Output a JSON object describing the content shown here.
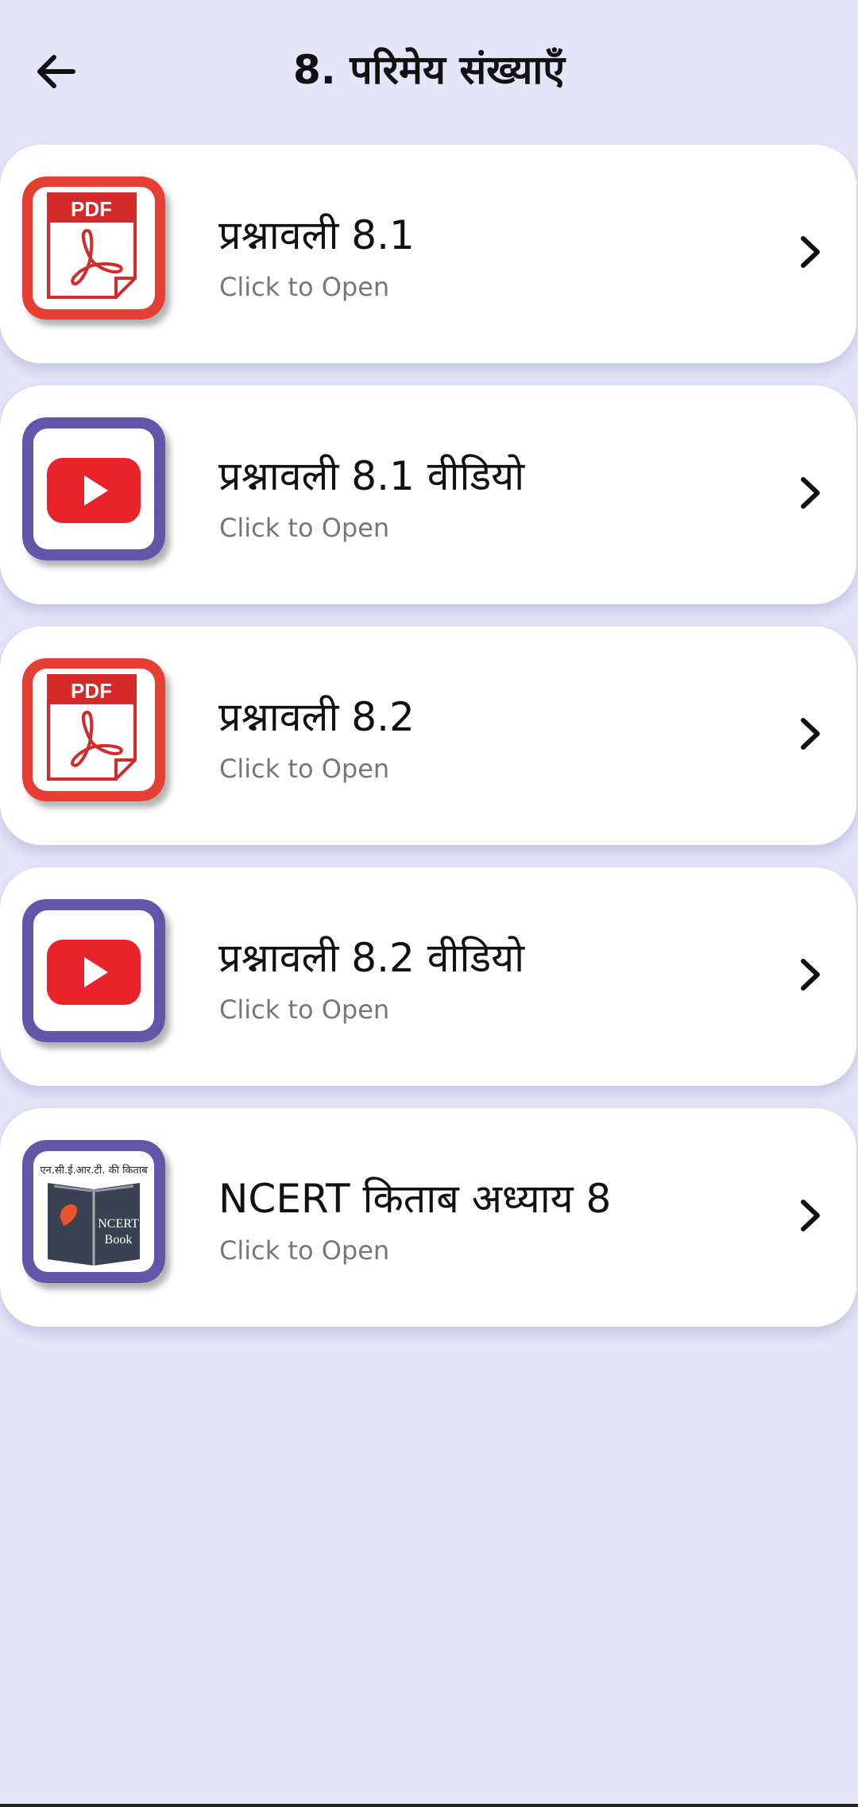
{
  "header": {
    "title": "8. परिमेय संख्याएँ",
    "back_icon": "arrow-left-icon"
  },
  "items": [
    {
      "title": "प्रश्नावली 8.1",
      "subtitle": "Click to Open",
      "icon": "pdf-icon",
      "frame_color": "#e0322f"
    },
    {
      "title": "प्रश्नावली 8.1 वीडियो",
      "subtitle": "Click to Open",
      "icon": "youtube-video-icon",
      "frame_color": "#6455a8"
    },
    {
      "title": "प्रश्नावली 8.2",
      "subtitle": "Click to Open",
      "icon": "pdf-icon",
      "frame_color": "#e0322f"
    },
    {
      "title": "प्रश्नावली 8.2 वीडियो",
      "subtitle": "Click to Open",
      "icon": "youtube-video-icon",
      "frame_color": "#6455a8"
    },
    {
      "title": "NCERT किताब अध्याय 8",
      "subtitle": "Click to Open",
      "icon": "ncert-book-icon",
      "frame_color": "#6455a8",
      "icon_caption": "एन.सी.ई.आर.टी. की किताब",
      "book_text": "NCERT Book"
    }
  ],
  "icon_labels": {
    "pdf": "PDF"
  },
  "colors": {
    "background": "#e4e5f8",
    "card": "#ffffff",
    "pdf_red": "#e0322f",
    "video_purple": "#6455a8",
    "youtube_red": "#e8232b"
  }
}
